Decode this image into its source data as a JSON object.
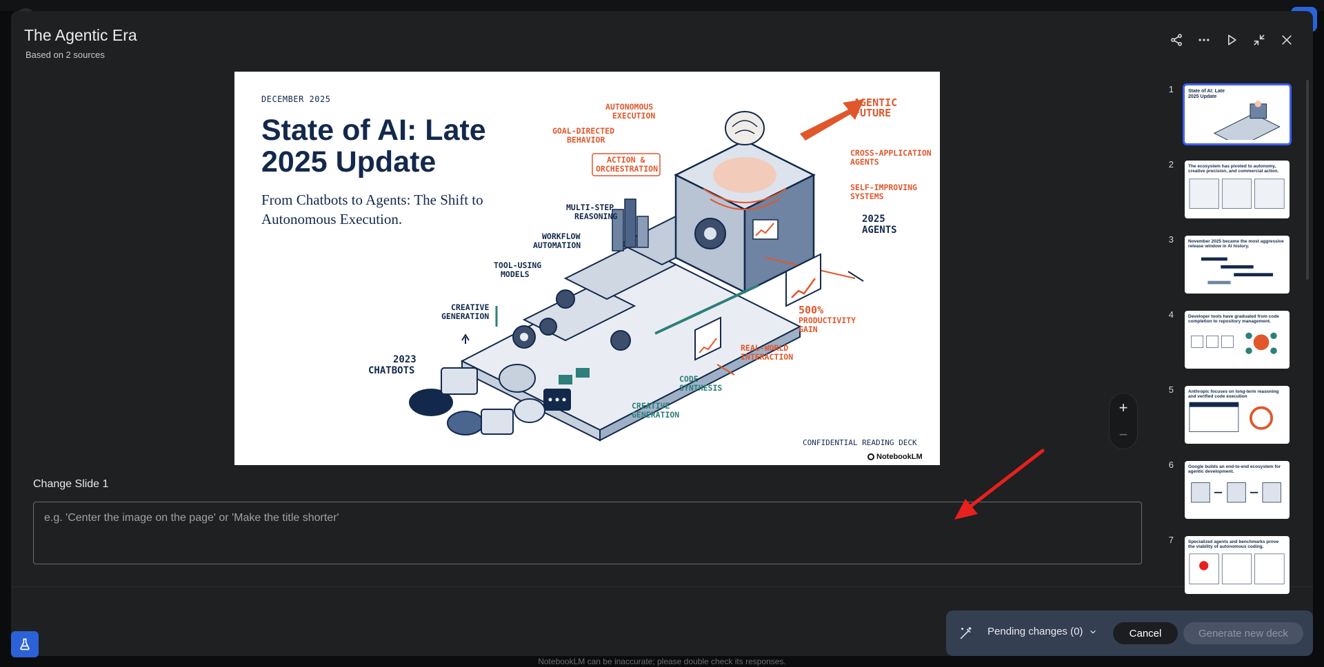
{
  "header": {
    "title": "The Agentic Era",
    "subtitle": "Based on 2 sources",
    "icons": [
      "share-icon",
      "more-icon",
      "play-icon",
      "collapse-icon",
      "close-icon"
    ]
  },
  "slide": {
    "date": "DECEMBER 2025",
    "title": "State of AI: Late 2025 Update",
    "subtitle": "From Chatbots to Agents: The Shift to Autonomous Execution.",
    "footer": "CONFIDENTIAL READING DECK",
    "logo": "NotebookLM",
    "labels": {
      "autonomous_execution": [
        "AUTONOMOUS",
        "EXECUTION"
      ],
      "agentic_future": [
        "AGENTIC",
        "FUTURE"
      ],
      "goal_directed": [
        "GOAL-DIRECTED",
        "BEHAVIOR"
      ],
      "action_orchestration": [
        "ACTION &",
        "ORCHESTRATION"
      ],
      "cross_app": [
        "CROSS-APPLICATION",
        "AGENTS"
      ],
      "self_improving": [
        "SELF-IMPROVING",
        "SYSTEMS"
      ],
      "multi_step": [
        "MULTI-STEP",
        "REASONING"
      ],
      "agents_2025": [
        "2025",
        "AGENTS"
      ],
      "workflow": [
        "WORKFLOW",
        "AUTOMATION"
      ],
      "tool_using": [
        "TOOL-USING",
        "MODELS"
      ],
      "creative_gen_1": [
        "CREATIVE",
        "GENERATION"
      ],
      "productivity": [
        "500%",
        "PRODUCTIVITY",
        "GAIN"
      ],
      "chatbots_2023": [
        "2023",
        "CHATBOTS"
      ],
      "real_world": [
        "REAL-WORLD",
        "INTERACTION"
      ],
      "code_synthesis": [
        "CODE",
        "SYNTHESIS"
      ],
      "creative_gen_2": [
        "CREATIVE",
        "GENERATION"
      ]
    }
  },
  "zoom": {
    "in": "+",
    "out": "−"
  },
  "editor": {
    "label": "Change Slide 1",
    "placeholder": "e.g. 'Center the image on the page' or 'Make the title shorter'",
    "value": ""
  },
  "thumbnails": [
    {
      "num": "1",
      "title": "State of AI: Late 2025 Update",
      "selected": true
    },
    {
      "num": "2",
      "title": "The ecosystem has pivoted to autonomy, creative precision, and commercial action."
    },
    {
      "num": "3",
      "title": "November 2025 became the most aggressive release window in AI history."
    },
    {
      "num": "4",
      "title": "Developer tools have graduated from code completion to repository management."
    },
    {
      "num": "5",
      "title": "Anthropic focuses on long-term reasoning and verified code execution"
    },
    {
      "num": "6",
      "title": "Google builds an end-to-end ecosystem for agentic development."
    },
    {
      "num": "7",
      "title": "Specialized agents and benchmarks prove the viability of autonomous coding."
    }
  ],
  "actions": {
    "pending": "Pending changes (0)",
    "cancel": "Cancel",
    "generate": "Generate new deck"
  },
  "footer_note": "NotebookLM can be inaccurate; please double check its responses.",
  "colors": {
    "accent": "#e1572c",
    "navy": "#13294b",
    "selected": "#3e5ff5",
    "annotation": "#e8201e"
  }
}
